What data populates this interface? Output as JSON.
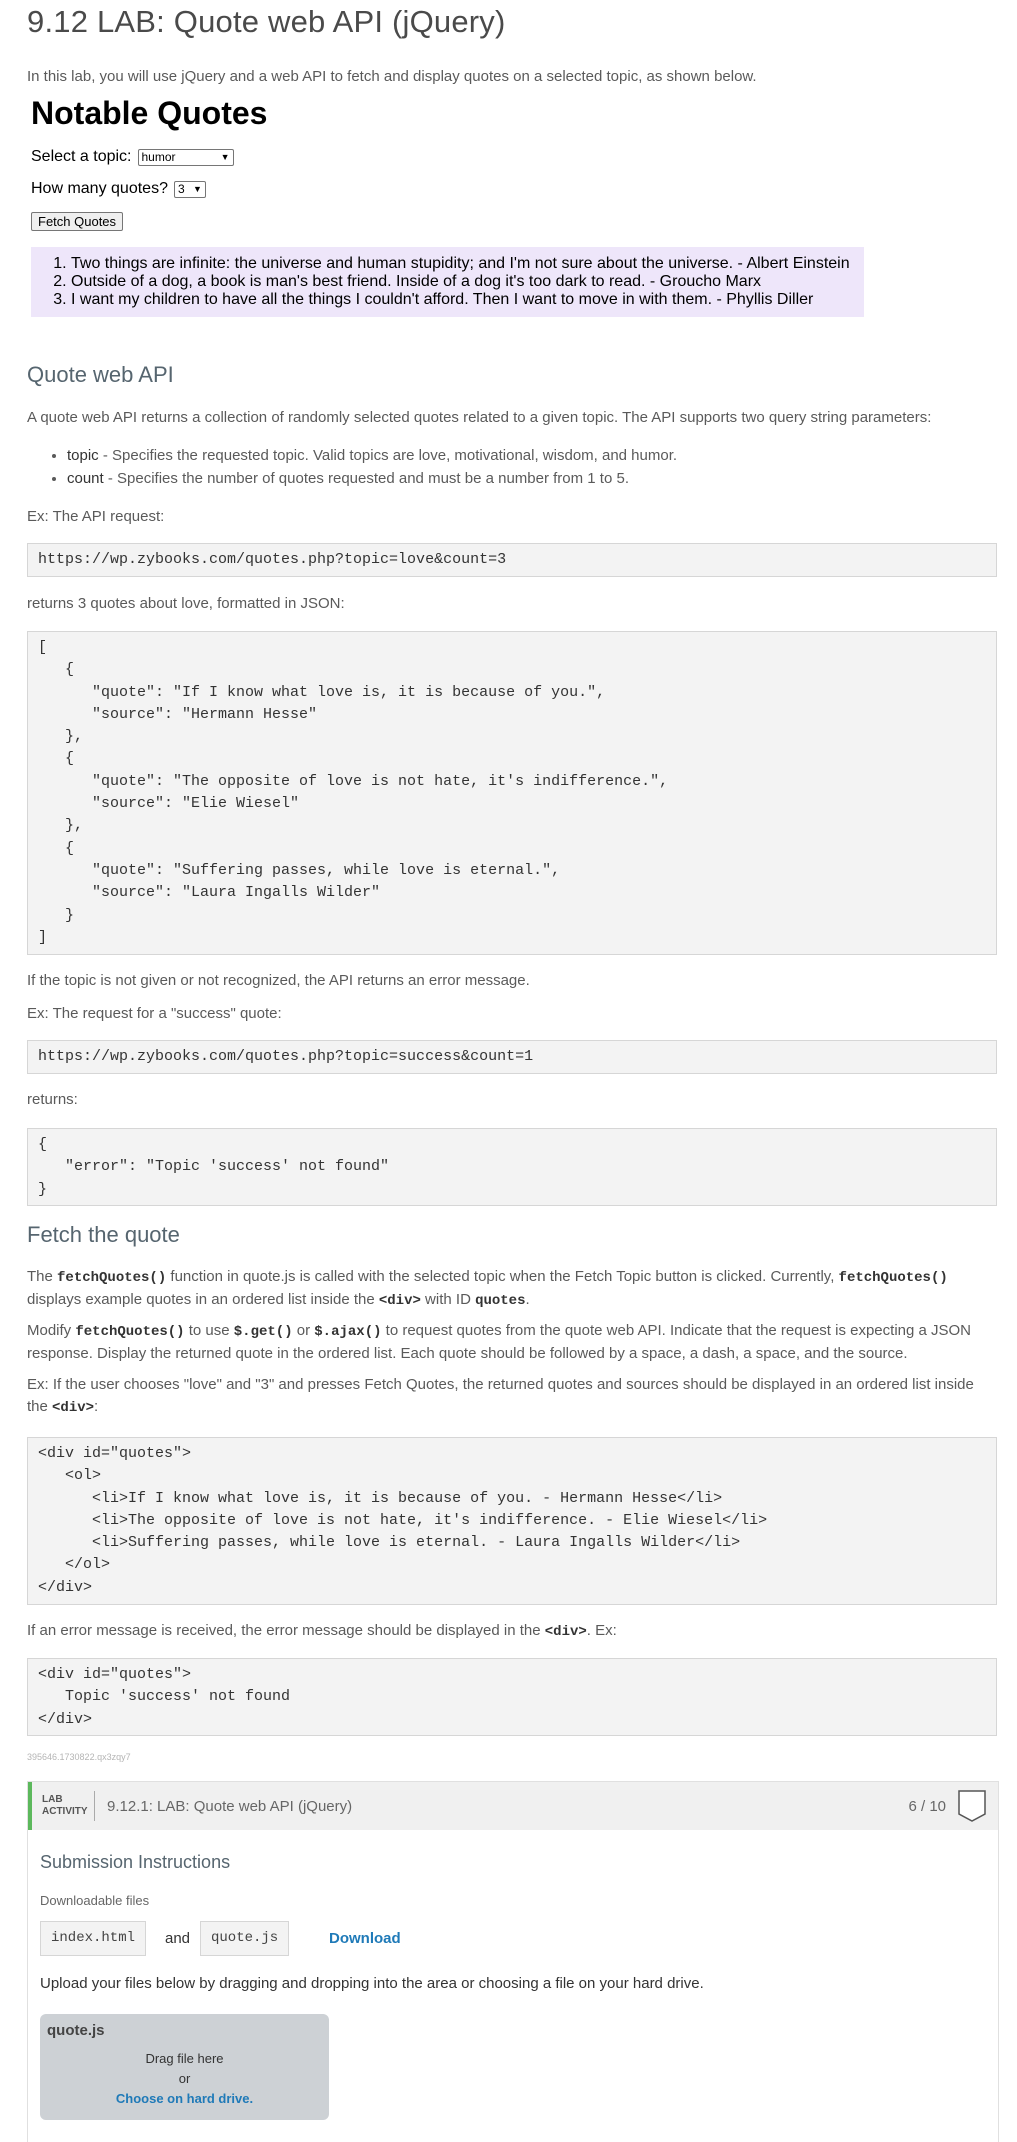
{
  "title": "9.12 LAB: Quote web API (jQuery)",
  "intro": "In this lab, you will use jQuery and a web API to fetch and display quotes on a selected topic, as shown below.",
  "demo": {
    "heading": "Notable Quotes",
    "topic_label": "Select a topic:",
    "topic_value": "humor",
    "count_label": "How many quotes?",
    "count_value": "3",
    "fetch_button": "Fetch Quotes",
    "quotes": [
      "Two things are infinite: the universe and human stupidity; and I'm not sure about the universe. - Albert Einstein",
      "Outside of a dog, a book is man's best friend. Inside of a dog it's too dark to read. - Groucho Marx",
      "I want my children to have all the things I couldn't afford. Then I want to move in with them. - Phyllis Diller"
    ]
  },
  "api_section": {
    "heading": "Quote web API",
    "p1": "A quote web API returns a collection of randomly selected quotes related to a given topic. The API supports two query string parameters:",
    "params": [
      {
        "name": "topic",
        "desc": " - Specifies the requested topic. Valid topics are love, motivational, wisdom, and humor."
      },
      {
        "name": "count",
        "desc": " - Specifies the number of quotes requested and must be a number from 1 to 5."
      }
    ],
    "ex1_label": "Ex: The API request:",
    "ex1_url": "https://wp.zybooks.com/quotes.php?topic=love&count=3",
    "returns1": "returns 3 quotes about love, formatted in JSON:",
    "json1": "[\n   {\n      \"quote\": \"If I know what love is, it is because of you.\",\n      \"source\": \"Hermann Hesse\"\n   },\n   {\n      \"quote\": \"The opposite of love is not hate, it's indifference.\",\n      \"source\": \"Elie Wiesel\"\n   },\n   {\n      \"quote\": \"Suffering passes, while love is eternal.\",\n      \"source\": \"Laura Ingalls Wilder\"\n   }\n]",
    "err_text": "If the topic is not given or not recognized, the API returns an error message.",
    "ex2_label": "Ex: The request for a \"success\" quote:",
    "ex2_url": "https://wp.zybooks.com/quotes.php?topic=success&count=1",
    "returns2": "returns:",
    "json2": "{\n   \"error\": \"Topic 'success' not found\"\n}"
  },
  "fetch_section": {
    "heading": "Fetch the quote",
    "p1_a": "The ",
    "p1_code1": "fetchQuotes()",
    "p1_b": " function in quote.js is called with the selected topic when the Fetch Topic button is clicked. Currently, ",
    "p1_code2": "fetchQuotes()",
    "p1_c": " displays example quotes in an ordered list inside the ",
    "p1_code3": "<div>",
    "p1_d": " with ID ",
    "p1_code4": "quotes",
    "p1_e": ".",
    "p2_a": "Modify ",
    "p2_code1": "fetchQuotes()",
    "p2_b": " to use ",
    "p2_code2": "$.get()",
    "p2_c": " or ",
    "p2_code3": "$.ajax()",
    "p2_d": " to request quotes from the quote web API. Indicate that the request is expecting a JSON response. Display the returned quote in the ordered list. Each quote should be followed by a space, a dash, a space, and the source.",
    "p3_a": "Ex: If the user chooses \"love\" and \"3\" and presses Fetch Quotes, the returned quotes and sources should be displayed in an ordered list inside the ",
    "p3_code": "<div>",
    "p3_b": ":",
    "html1": "<div id=\"quotes\">\n   <ol>\n      <li>If I know what love is, it is because of you. - Hermann Hesse</li>\n      <li>The opposite of love is not hate, it's indifference. - Elie Wiesel</li>\n      <li>Suffering passes, while love is eternal. - Laura Ingalls Wilder</li>\n   </ol>\n</div>",
    "p4_a": "If an error message is received, the error message should be displayed in the ",
    "p4_code": "<div>",
    "p4_b": ". Ex:",
    "html2": "<div id=\"quotes\">\n   Topic 'success' not found\n</div>"
  },
  "tracking_id": "395646.1730822.qx3zqy7",
  "lab": {
    "badge_line1": "LAB",
    "badge_line2": "ACTIVITY",
    "title": "9.12.1: LAB: Quote web API (jQuery)",
    "score": "6 / 10",
    "submission_title": "Submission Instructions",
    "downloadable_label": "Downloadable files",
    "file1": "index.html",
    "and_text": "and",
    "file2": "quote.js",
    "download_link": "Download",
    "upload_text": "Upload your files below by dragging and dropping into the area or choosing a file on your hard drive.",
    "dropzone_file": "quote.js",
    "drag_text": "Drag file here",
    "or_text": "or",
    "choose_text": "Choose on hard drive."
  },
  "colors": {
    "accent_green": "#5cb85c",
    "link_blue": "#1f7ab8",
    "quote_bg": "#eee6fa",
    "code_bg": "#f3f3f3"
  }
}
